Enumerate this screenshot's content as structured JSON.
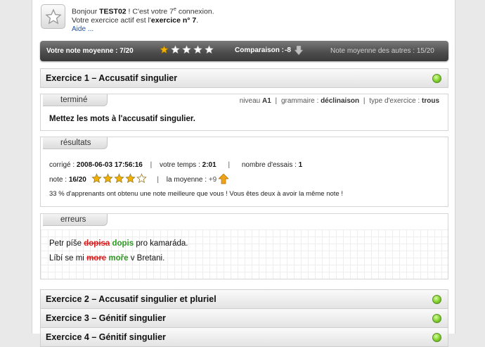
{
  "header": {
    "greeting_prefix": "Bonjour ",
    "username": "TEST02",
    "greeting_mid": " ! C'est votre 7",
    "greeting_sup": "e",
    "greeting_suffix": " connexion.",
    "active_prefix": "Votre exercice actif est l'",
    "active_exercise": "exercice n° 7",
    "active_suffix": ".",
    "help_link": "Aide ..."
  },
  "summary_bar": {
    "average_label": "Votre note moyenne : 7/20",
    "rating": {
      "filled": 1,
      "total": 5
    },
    "comparison_label": "Comparaison :",
    "comparison_value": "-8",
    "others_label": "Note moyenne des autres : 15/20"
  },
  "exercises": [
    {
      "title": "Exercice 1 – Accusatif singulier",
      "status": "done"
    },
    {
      "title": "Exercice 2 – Accusatif singulier et pluriel",
      "status": "done"
    },
    {
      "title": "Exercice 3 – Génitif singulier",
      "status": "done"
    },
    {
      "title": "Exercice 4 – Génitif singulier",
      "status": "done"
    }
  ],
  "status_panel": {
    "tab": "terminé",
    "level_label": "niveau",
    "level": "A1",
    "grammar_label": "grammaire :",
    "grammar": "déclinaison",
    "type_label": "type d'exercice :",
    "type": "trous",
    "instruction": "Mettez les mots à l'accusatif singulier."
  },
  "results_panel": {
    "tab": "résultats",
    "corrected_label": "corrigé :",
    "corrected": "2008-06-03 17:56:16",
    "time_label": "votre temps :",
    "time": "2:01",
    "attempts_label": "nombre d'essais :",
    "attempts": "1",
    "note_label": "note :",
    "note": "16/20",
    "note_rating": {
      "filled": 4,
      "total": 5
    },
    "average_label": "la moyenne :",
    "average_diff": "+9",
    "comparison_text": "33 % d'apprenants ont obtenu une note meilleure que vous ! Vous êtes deux à avoir la même note !"
  },
  "errors_panel": {
    "tab": "erreurs",
    "sentences": [
      {
        "before": "Petr píše ",
        "wrong": "dopisa",
        "correct": "dopis",
        "after": " pro kamaráda."
      },
      {
        "before": "Líbí se mi ",
        "wrong": "more",
        "correct": "moře",
        "after": " v Bretani."
      }
    ]
  },
  "colors": {
    "bar_dark": "#4e4e4e",
    "star_gold": "#f2b200",
    "error_red": "#d92121",
    "correct_green": "#2d9a22",
    "link_blue": "#1e4fa8",
    "status_green": "#7fcf2b",
    "arrow_orange": "#f0a21a"
  },
  "icons": {
    "favorite": "star-outline-icon",
    "rating": "star-icon",
    "down": "arrow-down-icon",
    "up": "arrow-up-icon",
    "status": "green-dot-icon"
  }
}
